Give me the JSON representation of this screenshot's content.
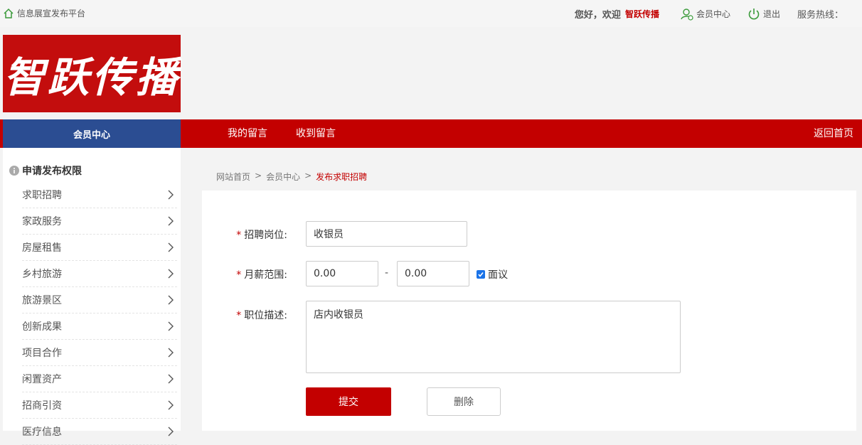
{
  "topbar": {
    "site_name": "信息展宣发布平台",
    "greeting": "您好，欢迎",
    "username": "智跃传播",
    "member_center": "会员中心",
    "logout": "退出",
    "hotline": "服务热线："
  },
  "logo": {
    "text": "智跃传播"
  },
  "nav": {
    "member_center": "会员中心",
    "items": [
      "我的留言",
      "收到留言"
    ],
    "home": "返回首页"
  },
  "sidebar": {
    "title": "申请发布权限",
    "items": [
      "求职招聘",
      "家政服务",
      "房屋租售",
      "乡村旅游",
      "旅游景区",
      "创新成果",
      "项目合作",
      "闲置资产",
      "招商引资",
      "医疗信息"
    ]
  },
  "breadcrumb": {
    "items": [
      "网站首页",
      "会员中心"
    ],
    "current": "发布求职招聘",
    "separator": ">"
  },
  "form": {
    "position_label": "招聘岗位:",
    "position_value": "收银员",
    "salary_label": "月薪范围:",
    "salary_min": "0.00",
    "salary_max": "0.00",
    "salary_dash": "-",
    "negotiable_label": "面议",
    "negotiable_checked": true,
    "desc_label": "职位描述:",
    "desc_value": "店内收银员",
    "required_mark": "*",
    "submit": "提交",
    "delete": "删除"
  },
  "colors": {
    "brand_red": "#c30000",
    "member_blue": "#2b4d92",
    "checkbox_blue": "#1a73e8"
  }
}
